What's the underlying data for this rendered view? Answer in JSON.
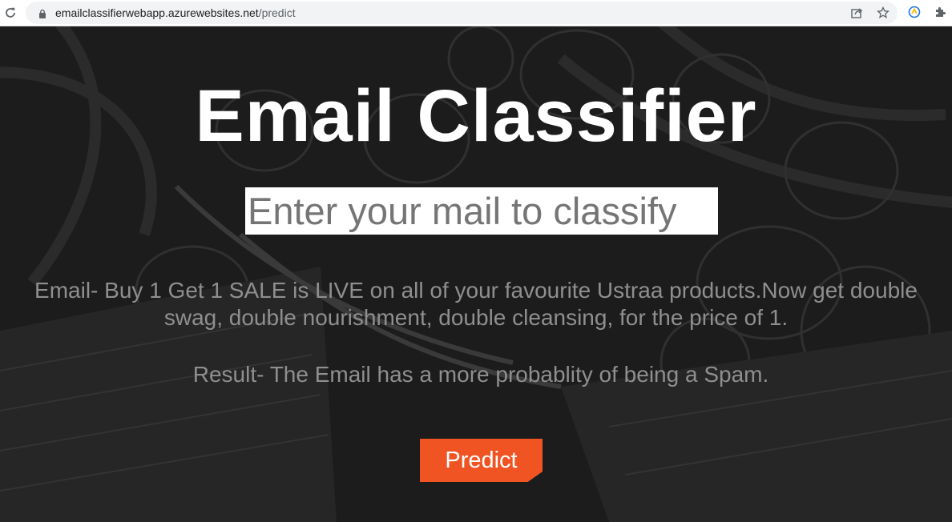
{
  "browser": {
    "url_host": "emailclassifierwebapp.azurewebsites.net",
    "url_path": "/predict",
    "icons": [
      "reload-icon",
      "lock-icon",
      "share-icon",
      "star-icon",
      "extension-icon",
      "puzzle-icon"
    ]
  },
  "page": {
    "title": "Email Classifier",
    "input_placeholder": "Enter your mail to classify",
    "email_text": "Email- Buy 1 Get 1 SALE is LIVE on all of your favourite Ustraa products.Now get double swag, double nourishment, double cleansing, for the price of 1.",
    "result_text": "Result- The Email has a more probablity of being a Spam.",
    "predict_label": "Predict"
  },
  "colors": {
    "background": "#1b1b1c",
    "title": "#ffffff",
    "body_text": "#8f8f8f",
    "button": "#f05423"
  }
}
